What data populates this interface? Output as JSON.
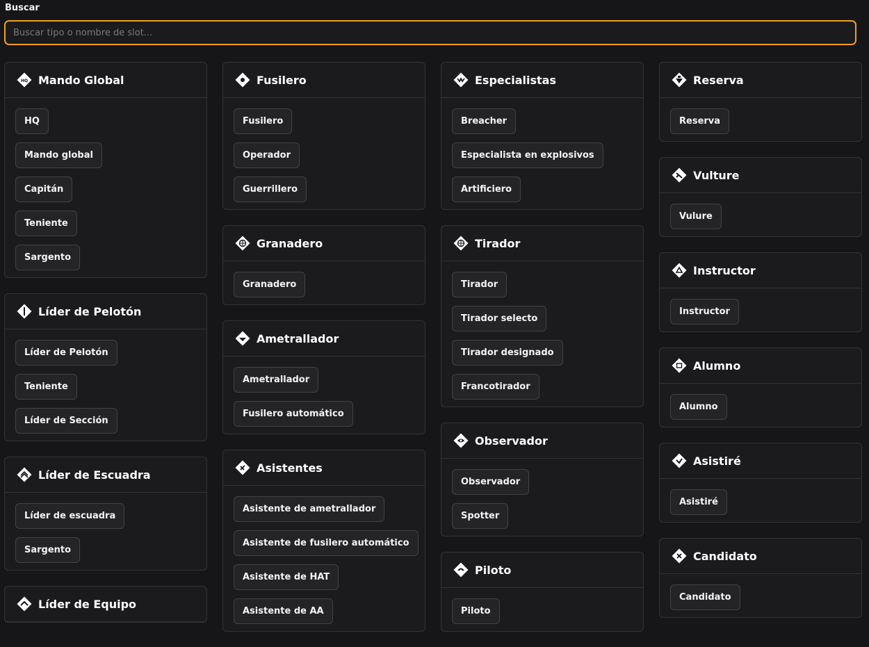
{
  "search": {
    "label": "Buscar",
    "placeholder": "Buscar tipo o nombre de slot...",
    "value": ""
  },
  "columns": [
    [
      {
        "title": "Mando Global",
        "icon": "hq-icon",
        "items": [
          "HQ",
          "Mando global",
          "Capitán",
          "Teniente",
          "Sargento"
        ]
      },
      {
        "title": "Líder de Pelotón",
        "icon": "platoon-leader-icon",
        "items": [
          "Líder de Pelotón",
          "Teniente",
          "Líder de Sección"
        ]
      },
      {
        "title": "Líder de Escuadra",
        "icon": "squad-leader-icon",
        "items": [
          "Líder de escuadra",
          "Sargento"
        ]
      },
      {
        "title": "Líder de Equipo",
        "icon": "team-leader-icon",
        "items": []
      }
    ],
    [
      {
        "title": "Fusilero",
        "icon": "rifleman-icon",
        "items": [
          "Fusilero",
          "Operador",
          "Guerrillero"
        ]
      },
      {
        "title": "Granadero",
        "icon": "grenadier-icon",
        "items": [
          "Granadero"
        ]
      },
      {
        "title": "Ametrallador",
        "icon": "machine-gunner-icon",
        "items": [
          "Ametrallador",
          "Fusilero automático"
        ]
      },
      {
        "title": "Asistentes",
        "icon": "assistant-icon",
        "items": [
          "Asistente de ametrallador",
          "Asistente de fusilero automático",
          "Asistente de HAT",
          "Asistente de AA"
        ]
      }
    ],
    [
      {
        "title": "Especialistas",
        "icon": "specialist-icon",
        "items": [
          "Breacher",
          "Especialista en explosivos",
          "Artificiero"
        ]
      },
      {
        "title": "Tirador",
        "icon": "marksman-icon",
        "items": [
          "Tirador",
          "Tirador selecto",
          "Tirador designado",
          "Francotirador"
        ]
      },
      {
        "title": "Observador",
        "icon": "observer-icon",
        "items": [
          "Observador",
          "Spotter"
        ]
      },
      {
        "title": "Piloto",
        "icon": "pilot-icon",
        "items": [
          "Piloto"
        ]
      }
    ],
    [
      {
        "title": "Reserva",
        "icon": "reserve-icon",
        "items": [
          "Reserva"
        ]
      },
      {
        "title": "Vulture",
        "icon": "vulture-icon",
        "items": [
          "Vulure"
        ]
      },
      {
        "title": "Instructor",
        "icon": "instructor-icon",
        "items": [
          "Instructor"
        ]
      },
      {
        "title": "Alumno",
        "icon": "student-icon",
        "items": [
          "Alumno"
        ]
      },
      {
        "title": "Asistiré",
        "icon": "attending-icon",
        "items": [
          "Asistiré"
        ]
      },
      {
        "title": "Candidato",
        "icon": "candidate-icon",
        "items": [
          "Candidato"
        ]
      }
    ]
  ]
}
